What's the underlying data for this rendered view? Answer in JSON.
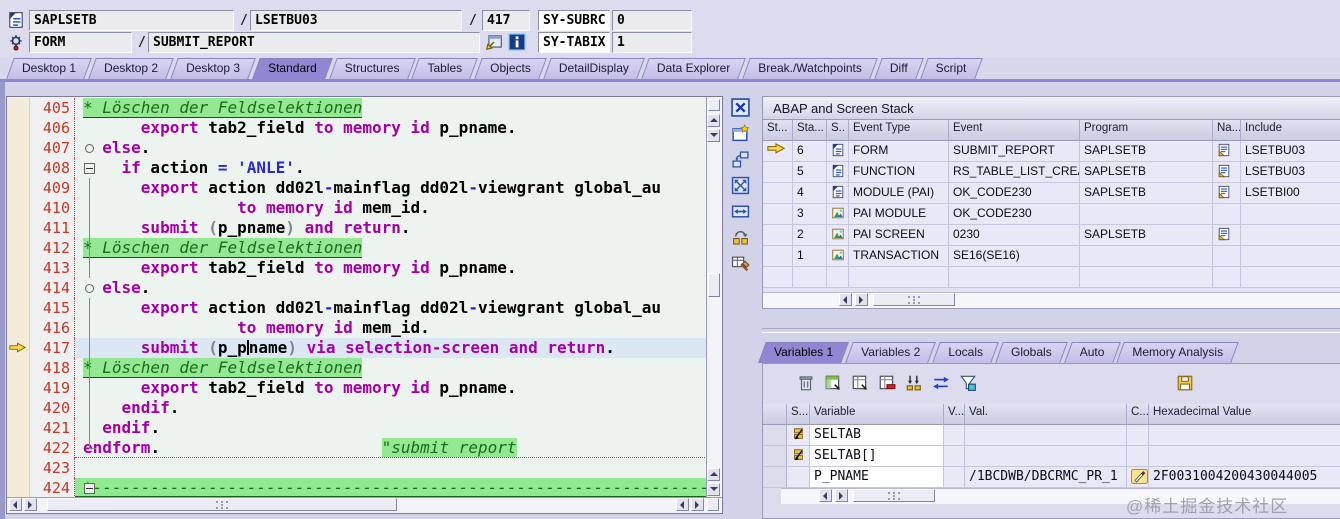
{
  "topbar": {
    "row1": {
      "program": "SAPLSETB",
      "slash1": "/",
      "include": "LSETBU03",
      "slash2": "/",
      "line_no": "417",
      "sysfield_label": "SY-SUBRC",
      "sysfield_value": "0"
    },
    "row2": {
      "event_type": "FORM",
      "slash": "/",
      "event_name": "SUBMIT_REPORT",
      "sysfield_label": "SY-TABIX",
      "sysfield_value": "1"
    }
  },
  "desktop_tabs": {
    "items": [
      "Desktop 1",
      "Desktop 2",
      "Desktop 3",
      "Standard",
      "Structures",
      "Tables",
      "Objects",
      "DetailDisplay",
      "Data Explorer",
      "Break./Watchpoints",
      "Diff",
      "Script"
    ],
    "active": "Standard"
  },
  "editor": {
    "current_line": 417,
    "toolbar_icons": [
      "close-icon",
      "new-window-icon",
      "swap-panes-icon",
      "maximize-icon",
      "fit-width-icon",
      "exchange-icon",
      "table-tools-icon"
    ],
    "lines": [
      {
        "n": 405,
        "fold": "",
        "segs": [
          [
            "c",
            "* Löschen der Feldselektionen"
          ]
        ]
      },
      {
        "n": 406,
        "fold": "",
        "segs": [
          [
            "t",
            "      "
          ],
          [
            "k",
            "export"
          ],
          [
            "i",
            " tab2_field "
          ],
          [
            "k",
            "to memory id"
          ],
          [
            "i",
            " p_pname."
          ]
        ]
      },
      {
        "n": 407,
        "fold": "ring",
        "segs": [
          [
            "t",
            "  "
          ],
          [
            "k",
            "else"
          ],
          [
            "i",
            "."
          ]
        ]
      },
      {
        "n": 408,
        "fold": "box",
        "segs": [
          [
            "t",
            "    "
          ],
          [
            "k",
            "if"
          ],
          [
            "i",
            " action "
          ],
          [
            "o",
            "="
          ],
          [
            "t",
            " "
          ],
          [
            "s",
            "'ANLE'"
          ],
          [
            "i",
            "."
          ]
        ]
      },
      {
        "n": 409,
        "fold": "line",
        "segs": [
          [
            "t",
            "      "
          ],
          [
            "k",
            "export"
          ],
          [
            "i",
            " action dd02l"
          ],
          [
            "o",
            "-"
          ],
          [
            "i",
            "mainflag dd02l"
          ],
          [
            "o",
            "-"
          ],
          [
            "i",
            "viewgrant global_au"
          ]
        ]
      },
      {
        "n": 410,
        "fold": "line",
        "segs": [
          [
            "t",
            "                "
          ],
          [
            "k",
            "to memory id"
          ],
          [
            "i",
            " mem_id."
          ]
        ]
      },
      {
        "n": 411,
        "fold": "line",
        "segs": [
          [
            "t",
            "      "
          ],
          [
            "k",
            "submit"
          ],
          [
            "t",
            " "
          ],
          [
            "p",
            "("
          ],
          [
            "i",
            "p_pname"
          ],
          [
            "p",
            ")"
          ],
          [
            "t",
            " "
          ],
          [
            "k",
            "and return"
          ],
          [
            "i",
            "."
          ]
        ]
      },
      {
        "n": 412,
        "fold": "line",
        "segs": [
          [
            "c",
            "* Löschen der Feldselektionen"
          ]
        ]
      },
      {
        "n": 413,
        "fold": "line",
        "segs": [
          [
            "t",
            "      "
          ],
          [
            "k",
            "export"
          ],
          [
            "i",
            " tab2_field "
          ],
          [
            "k",
            "to memory id"
          ],
          [
            "i",
            " p_pname."
          ]
        ]
      },
      {
        "n": 414,
        "fold": "ring",
        "segs": [
          [
            "t",
            "  "
          ],
          [
            "k",
            "else"
          ],
          [
            "i",
            "."
          ]
        ]
      },
      {
        "n": 415,
        "fold": "line",
        "segs": [
          [
            "t",
            "      "
          ],
          [
            "k",
            "export"
          ],
          [
            "i",
            " action dd02l"
          ],
          [
            "o",
            "-"
          ],
          [
            "i",
            "mainflag dd02l"
          ],
          [
            "o",
            "-"
          ],
          [
            "i",
            "viewgrant global_au"
          ]
        ]
      },
      {
        "n": 416,
        "fold": "line",
        "segs": [
          [
            "t",
            "                "
          ],
          [
            "k",
            "to memory id"
          ],
          [
            "i",
            " mem_id."
          ]
        ]
      },
      {
        "n": 417,
        "fold": "line",
        "current": true,
        "segs": [
          [
            "t",
            "      "
          ],
          [
            "k",
            "submit"
          ],
          [
            "t",
            " "
          ],
          [
            "p",
            "("
          ],
          [
            "i",
            "p_p"
          ],
          [
            "cur",
            ""
          ],
          [
            "i",
            "name"
          ],
          [
            "p",
            ")"
          ],
          [
            "t",
            " "
          ],
          [
            "k",
            "via selection-screen and return"
          ],
          [
            "i",
            "."
          ]
        ]
      },
      {
        "n": 418,
        "fold": "line",
        "segs": [
          [
            "c",
            "* Löschen der Feldselektionen"
          ]
        ]
      },
      {
        "n": 419,
        "fold": "line",
        "segs": [
          [
            "t",
            "      "
          ],
          [
            "k",
            "export"
          ],
          [
            "i",
            " tab2_field "
          ],
          [
            "k",
            "to memory id"
          ],
          [
            "i",
            " p_pname."
          ]
        ]
      },
      {
        "n": 420,
        "fold": "line",
        "segs": [
          [
            "t",
            "    "
          ],
          [
            "k",
            "endif"
          ],
          [
            "i",
            "."
          ]
        ]
      },
      {
        "n": 421,
        "fold": "line",
        "segs": [
          [
            "t",
            "  "
          ],
          [
            "k",
            "endif"
          ],
          [
            "i",
            "."
          ]
        ]
      },
      {
        "n": 422,
        "fold": "end",
        "sep": true,
        "segs": [
          [
            "k",
            "endform"
          ],
          [
            "i",
            "."
          ],
          [
            "t",
            "                       "
          ],
          [
            "c",
            "\"submit report"
          ]
        ]
      },
      {
        "n": 423,
        "fold": "",
        "segs": []
      },
      {
        "n": 424,
        "fold": "box",
        "fullgreen": true,
        "segs": [
          [
            "cg",
            "*---------------------------------------------------------------------------"
          ]
        ]
      }
    ]
  },
  "stack": {
    "title": "ABAP and Screen Stack",
    "columns": [
      "St...",
      "Sta...",
      "S..",
      "Event Type",
      "Event",
      "Program",
      "Na...",
      "Include"
    ],
    "rows": [
      {
        "current": true,
        "level": "6",
        "type_icon": "abap",
        "event_type": "FORM",
        "event": "SUBMIT_REPORT",
        "program": "SAPLSETB",
        "nav": true,
        "include": "LSETBU03"
      },
      {
        "current": false,
        "level": "5",
        "type_icon": "abap",
        "event_type": "FUNCTION",
        "event": "RS_TABLE_LIST_CREATE",
        "program": "SAPLSETB",
        "nav": true,
        "include": "LSETBU03"
      },
      {
        "current": false,
        "level": "4",
        "type_icon": "abap",
        "event_type": "MODULE (PAI)",
        "event": "OK_CODE230",
        "program": "SAPLSETB",
        "nav": true,
        "include": "LSETBI00"
      },
      {
        "current": false,
        "level": "3",
        "type_icon": "screen",
        "event_type": "PAI MODULE",
        "event": "OK_CODE230",
        "program": "",
        "nav": false,
        "include": ""
      },
      {
        "current": false,
        "level": "2",
        "type_icon": "screen",
        "event_type": "PAI SCREEN",
        "event": "0230",
        "program": "SAPLSETB",
        "nav": true,
        "include": ""
      },
      {
        "current": false,
        "level": "1",
        "type_icon": "screen",
        "event_type": "TRANSACTION",
        "event": "SE16(SE16)",
        "program": "",
        "nav": false,
        "include": ""
      }
    ]
  },
  "variables_panel": {
    "tabs": [
      "Variables 1",
      "Variables 2",
      "Locals",
      "Globals",
      "Auto",
      "Memory Analysis"
    ],
    "active": "Variables 1",
    "toolbar_icons": [
      "delete-icon",
      "create-icon",
      "display-icon",
      "remove-row-icon",
      "columns-icon",
      "swap-icon",
      "filter-icon"
    ],
    "save_icon": "save-icon",
    "table": {
      "columns": [
        "",
        "S...",
        "Variable",
        "V...",
        "Val.",
        "C...",
        "Hexadecimal Value"
      ],
      "rows": [
        {
          "type_icon": "itab",
          "name": "SELTAB",
          "val": "",
          "changeable": false,
          "hex": ""
        },
        {
          "type_icon": "itab",
          "name": "SELTAB[]",
          "val": "",
          "changeable": false,
          "hex": ""
        },
        {
          "type_icon": "",
          "name": "P_PNAME",
          "val": "/1BCDWB/DBCRMC_PR_1",
          "changeable": true,
          "hex": "2F0031004200430044005"
        }
      ]
    }
  },
  "watermark": "@稀土掘金技术社区"
}
